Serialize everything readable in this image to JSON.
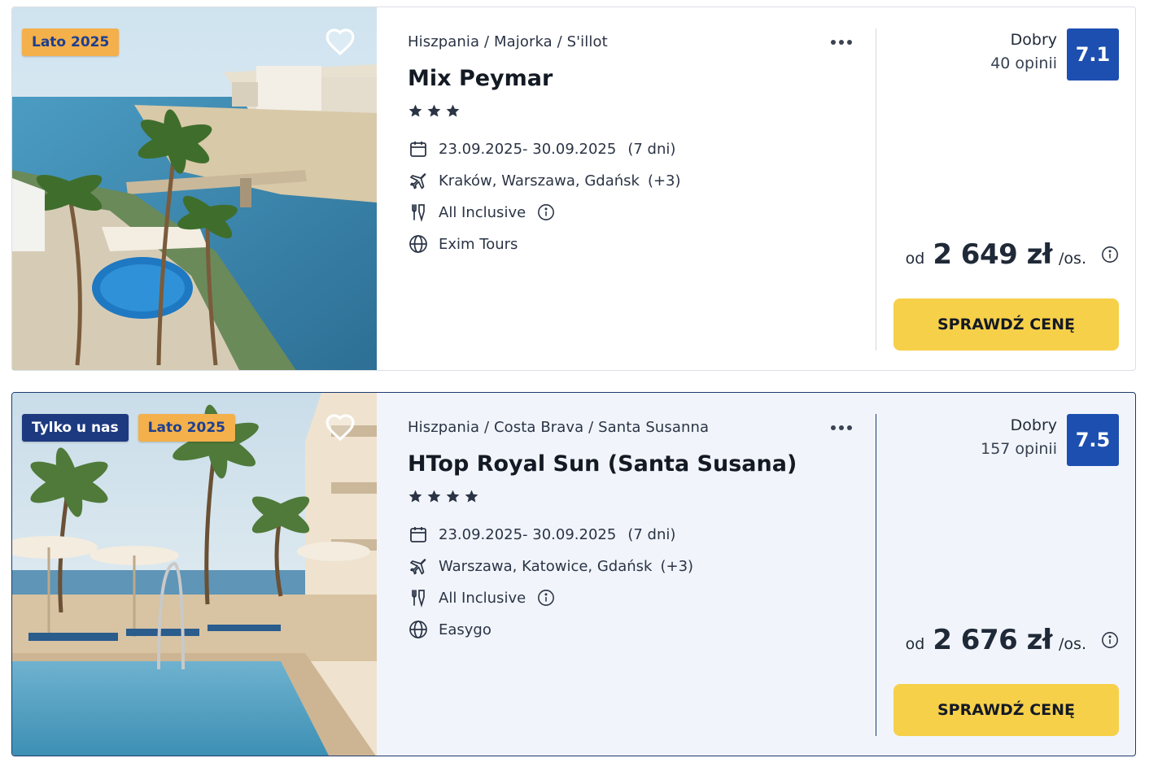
{
  "offers": [
    {
      "badges": [
        "Lato 2025"
      ],
      "breadcrumb": "Hiszpania / Majorka / S'illot",
      "name": "Mix Peymar",
      "stars": 3,
      "dates": "23.09.2025- 30.09.2025",
      "duration": "(7 dni)",
      "departures": "Kraków, Warszawa, Gdańsk",
      "departures_more": "(+3)",
      "board": "All Inclusive",
      "operator": "Exim Tours",
      "rating_label": "Dobry",
      "rating_count": "40 opinii",
      "score": "7.1",
      "price_prefix": "od",
      "price": "2 649 zł",
      "price_suffix": "/os.",
      "cta": "SPRAWDŹ CENĘ"
    },
    {
      "badges": [
        "Tylko u nas",
        "Lato 2025"
      ],
      "breadcrumb": "Hiszpania / Costa Brava / Santa Susanna",
      "name": "HTop Royal Sun (Santa Susana)",
      "stars": 4,
      "dates": "23.09.2025- 30.09.2025",
      "duration": "(7 dni)",
      "departures": "Warszawa, Katowice, Gdańsk",
      "departures_more": "(+3)",
      "board": "All Inclusive",
      "operator": "Easygo",
      "rating_label": "Dobry",
      "rating_count": "157 opinii",
      "score": "7.5",
      "price_prefix": "od",
      "price": "2 676 zł",
      "price_suffix": "/os.",
      "cta": "SPRAWDŹ CENĘ"
    }
  ],
  "icons": {
    "favorite": "heart-outline-icon",
    "more": "more-horizontal-icon",
    "star": "star-icon",
    "dates": "calendar-icon",
    "departures": "airplane-icon",
    "board": "cutlery-icon",
    "operator": "globe-icon",
    "info": "info-circle-icon"
  },
  "colors": {
    "score_bg": "#1d4fb0",
    "cta_bg": "#f7d04a",
    "badge_season": "#f4b04a",
    "badge_exclusive": "#1d3a80",
    "highlight_bg": "#f1f5fb"
  }
}
